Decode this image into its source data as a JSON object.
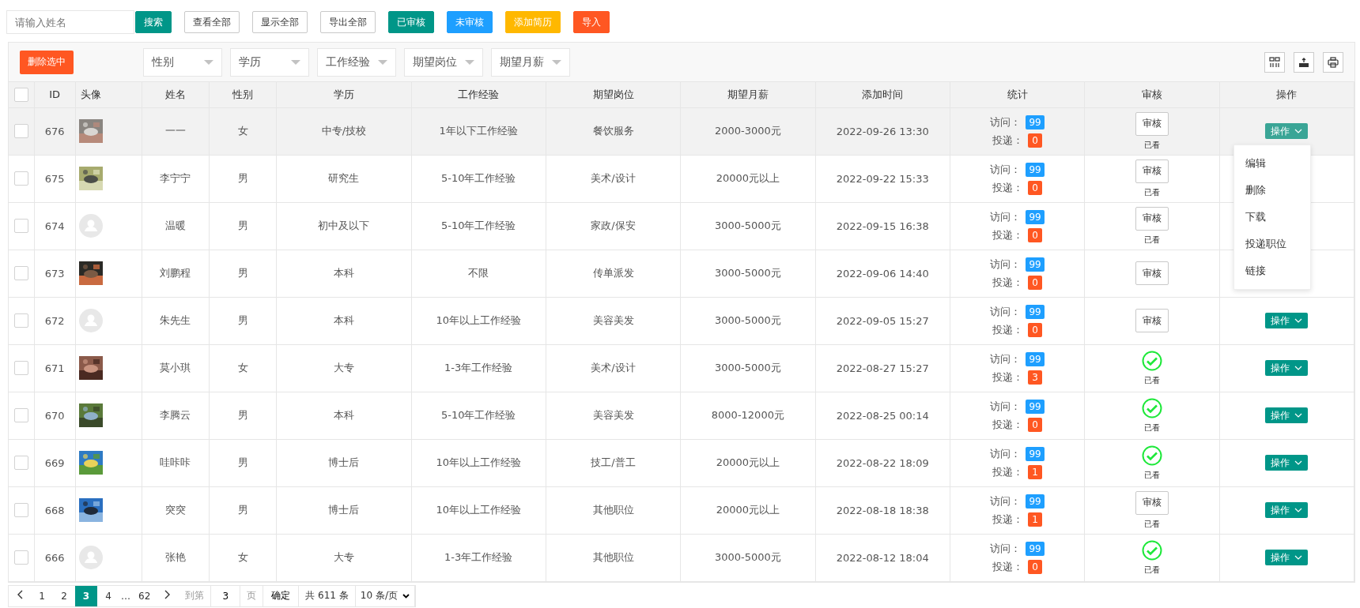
{
  "top_bar": {
    "search": {
      "placeholder": "请输入姓名"
    },
    "buttons": [
      {
        "label": "搜索",
        "kind": "primary"
      },
      {
        "label": "查看全部",
        "kind": "outline"
      },
      {
        "label": "显示全部",
        "kind": "outline"
      },
      {
        "label": "导出全部",
        "kind": "outline"
      },
      {
        "label": "已审核",
        "kind": "primary"
      },
      {
        "label": "未审核",
        "kind": "info"
      },
      {
        "label": "添加简历",
        "kind": "warning"
      },
      {
        "label": "导入",
        "kind": "danger"
      }
    ]
  },
  "toolbar": {
    "delete_button": "删除选中",
    "filters": [
      "性别",
      "学历",
      "工作经验",
      "期望岗位",
      "期望月薪"
    ]
  },
  "table": {
    "header_checked": false,
    "columns": [
      "ID",
      "头像",
      "姓名",
      "性别",
      "学历",
      "工作经验",
      "期望岗位",
      "期望月薪",
      "添加时间",
      "统计",
      "审核",
      "操作"
    ],
    "rows": [
      {
        "checked": false,
        "hovered": true,
        "id": "676",
        "name": "一一",
        "gender": "女",
        "education": "中专/技校",
        "experience": "1年以下工作经验",
        "position": "餐饮服务",
        "salary": "2000-3000元",
        "added": "2022-09-26 13:30",
        "visits_label": "访问：",
        "visits": "99",
        "deliveries_label": "投递：",
        "deliveries": "0",
        "review": {
          "kind": "button",
          "label": "审核",
          "note": "已看"
        },
        "action": "操作"
      },
      {
        "checked": false,
        "hovered": false,
        "id": "675",
        "name": "李宁宁",
        "gender": "男",
        "education": "研究生",
        "experience": "5-10年工作经验",
        "position": "美术/设计",
        "salary": "20000元以上",
        "added": "2022-09-22 15:33",
        "visits_label": "访问：",
        "visits": "99",
        "deliveries_label": "投递：",
        "deliveries": "0",
        "review": {
          "kind": "button",
          "label": "审核",
          "note": "已看"
        }
      },
      {
        "checked": false,
        "hovered": false,
        "id": "674",
        "avatar": {
          "kind": "placeholder"
        },
        "name": "温暖",
        "gender": "男",
        "education": "初中及以下",
        "experience": "5-10年工作经验",
        "position": "家政/保安",
        "salary": "3000-5000元",
        "added": "2022-09-15 16:38",
        "visits_label": "访问：",
        "visits": "99",
        "deliveries_label": "投递：",
        "deliveries": "0",
        "review": {
          "kind": "button",
          "label": "审核",
          "note": "已看"
        }
      },
      {
        "checked": false,
        "hovered": false,
        "id": "673",
        "name": "刘鹏程",
        "gender": "男",
        "education": "本科",
        "experience": "不限",
        "position": "传单派发",
        "salary": "3000-5000元",
        "added": "2022-09-06 14:40",
        "visits_label": "访问：",
        "visits": "99",
        "deliveries_label": "投递：",
        "deliveries": "0",
        "review": {
          "kind": "button",
          "label": "审核"
        }
      },
      {
        "checked": false,
        "hovered": false,
        "id": "672",
        "avatar": {
          "kind": "placeholder"
        },
        "name": "朱先生",
        "gender": "男",
        "education": "本科",
        "experience": "10年以上工作经验",
        "position": "美容美发",
        "salary": "3000-5000元",
        "added": "2022-09-05 15:27",
        "visits_label": "访问：",
        "visits": "99",
        "deliveries_label": "投递：",
        "deliveries": "0",
        "review": {
          "kind": "button",
          "label": "审核"
        },
        "action": "操作"
      },
      {
        "checked": false,
        "hovered": false,
        "id": "671",
        "name": "莫小琪",
        "gender": "女",
        "education": "大专",
        "experience": "1-3年工作经验",
        "position": "美术/设计",
        "salary": "3000-5000元",
        "added": "2022-08-27 15:27",
        "visits_label": "访问：",
        "visits": "99",
        "deliveries_label": "投递：",
        "deliveries": "3",
        "review": {
          "kind": "approved",
          "note": "已看"
        },
        "action": "操作"
      },
      {
        "checked": false,
        "hovered": false,
        "id": "670",
        "name": "李腾云",
        "gender": "男",
        "education": "本科",
        "experience": "5-10年工作经验",
        "position": "美容美发",
        "salary": "8000-12000元",
        "added": "2022-08-25 00:14",
        "visits_label": "访问：",
        "visits": "99",
        "deliveries_label": "投递：",
        "deliveries": "0",
        "review": {
          "kind": "approved",
          "note": "已看"
        },
        "action": "操作"
      },
      {
        "checked": false,
        "hovered": false,
        "id": "669",
        "name": "哇咔咔",
        "gender": "男",
        "education": "博士后",
        "experience": "10年以上工作经验",
        "position": "技工/普工",
        "salary": "20000元以上",
        "added": "2022-08-22 18:09",
        "visits_label": "访问：",
        "visits": "99",
        "deliveries_label": "投递：",
        "deliveries": "1",
        "review": {
          "kind": "approved",
          "note": "已看"
        },
        "action": "操作"
      },
      {
        "checked": false,
        "hovered": false,
        "id": "668",
        "name": "突突",
        "gender": "男",
        "education": "博士后",
        "experience": "10年以上工作经验",
        "position": "其他职位",
        "salary": "20000元以上",
        "added": "2022-08-18 18:38",
        "visits_label": "访问：",
        "visits": "99",
        "deliveries_label": "投递：",
        "deliveries": "1",
        "review": {
          "kind": "button",
          "label": "审核",
          "note": "已看"
        },
        "action": "操作"
      },
      {
        "checked": false,
        "hovered": false,
        "id": "666",
        "avatar": {
          "kind": "placeholder"
        },
        "name": "张艳",
        "gender": "女",
        "education": "大专",
        "experience": "1-3年工作经验",
        "position": "其他职位",
        "salary": "3000-5000元",
        "added": "2022-08-12 18:04",
        "visits_label": "访问：",
        "visits": "99",
        "deliveries_label": "投递：",
        "deliveries": "0",
        "review": {
          "kind": "approved",
          "note": "已看"
        },
        "action": "操作"
      }
    ],
    "action_menu": {
      "items": [
        "编辑",
        "删除",
        "下载",
        "投递职位",
        "链接"
      ]
    }
  },
  "pagination": {
    "pages": [
      {
        "label": "1",
        "kind": "page",
        "selected": false
      },
      {
        "label": "2",
        "kind": "page",
        "selected": false
      },
      {
        "label": "3",
        "kind": "page",
        "selected": true
      },
      {
        "label": "4",
        "kind": "page",
        "selected": false
      },
      {
        "label": "…",
        "kind": "ellipsis"
      },
      {
        "label": "62",
        "kind": "page",
        "selected": false
      }
    ],
    "goto_label": "到第",
    "goto_value": "3",
    "page_unit": "页",
    "confirm": "确定",
    "total": "共 611 条",
    "page_size": "10 条/页"
  }
}
